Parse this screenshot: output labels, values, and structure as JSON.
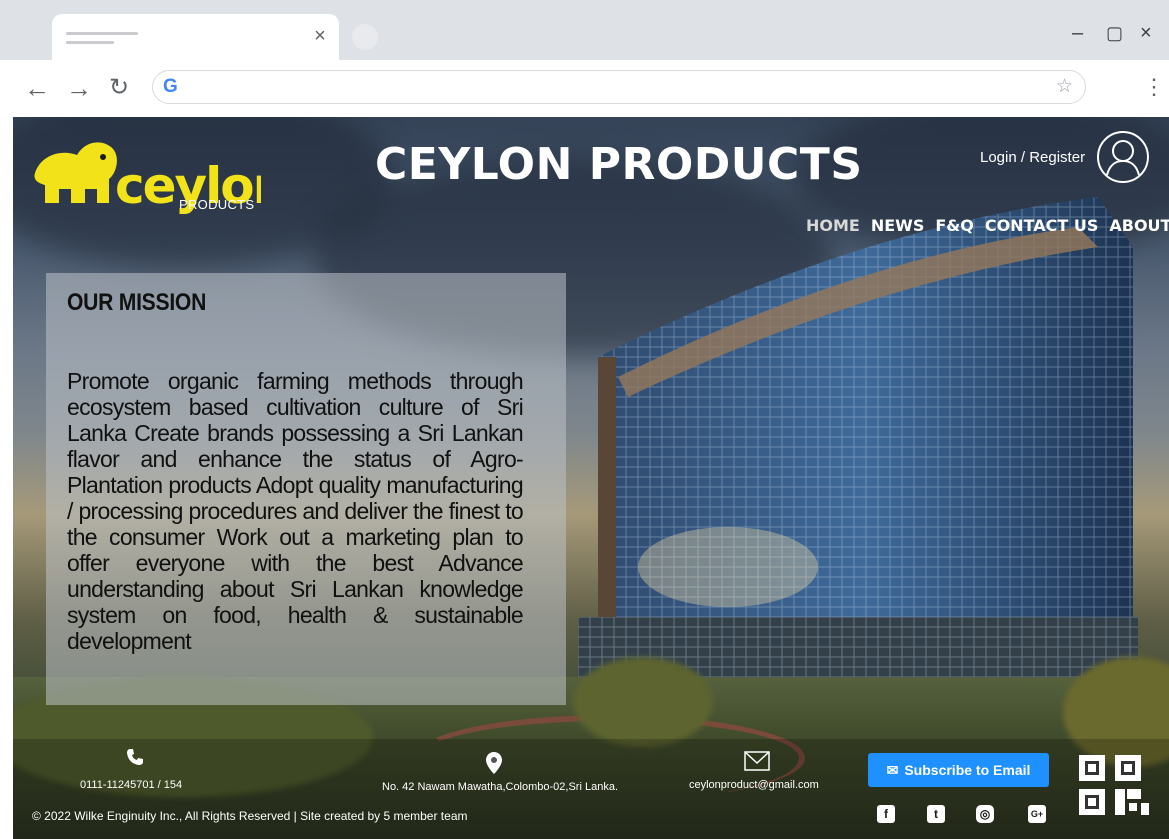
{
  "browser": {
    "tab_close": "×",
    "nav": {
      "back": "←",
      "forward": "→",
      "reload": "↻"
    },
    "window_controls": {
      "minimize": "–",
      "maximize": "▢",
      "close": "×"
    },
    "omnibox": {
      "icon": "google-icon",
      "icon_text": "G",
      "value": "",
      "star": "☆"
    },
    "menu": "⋮"
  },
  "header": {
    "logo_text": "ceylon",
    "logo_subtext": "PRODUCTS",
    "title": "CEYLON PRODUCTS",
    "login": "Login / Register"
  },
  "nav": {
    "items": [
      {
        "label": "HOME",
        "active": true
      },
      {
        "label": "NEWS"
      },
      {
        "label": "F&Q"
      },
      {
        "label": "CONTACT US"
      },
      {
        "label": "ABOUT"
      }
    ]
  },
  "mission": {
    "title": "OUR MISSION",
    "body": "Promote organic farming methods through ecosystem based cultivation culture of Sri Lanka Create brands possessing a Sri Lankan flavor and enhance the status of Agro-Plantation products Adopt quality manufacturing / processing procedures and deliver the finest to the consumer Work out a marketing plan to offer everyone with the best Advance understanding about Sri Lankan knowledge system on food, health & sustainable development"
  },
  "footer": {
    "phone": "0111-11245701 / 154",
    "address": "No. 42 Nawam Mawatha,Colombo-02,Sri Lanka.",
    "email": "ceylonproduct@gmail.com",
    "subscribe": "Subscribe to Email",
    "copyright": "© 2022 Wilke Enginuity Inc., All Rights Reserved | Site created by 5 member team",
    "social": [
      "facebook-icon",
      "twitter-icon",
      "instagram-icon",
      "google-plus-icon"
    ]
  },
  "colors": {
    "logo_yellow": "#f2e21a",
    "subscribe_blue": "#1e90ff"
  }
}
